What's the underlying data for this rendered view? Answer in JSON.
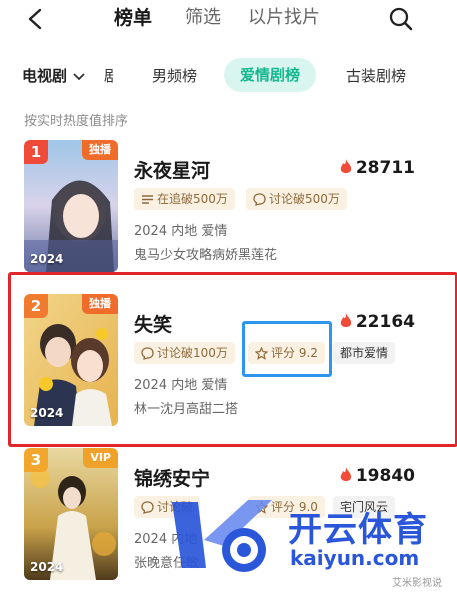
{
  "nav": {
    "tabs": [
      {
        "label": "榜单",
        "active": true
      },
      {
        "label": "筛选",
        "active": false
      },
      {
        "label": "以片找片",
        "active": false
      }
    ]
  },
  "subnav": {
    "dropdown_label": "电视剧",
    "partial_label": "剧",
    "tabs": [
      {
        "label": "男频榜",
        "active": false
      },
      {
        "label": "爱情剧榜",
        "active": true
      },
      {
        "label": "古装剧榜",
        "active": false
      }
    ]
  },
  "sort_note": "按实时热度值排序",
  "items": [
    {
      "rank": "1",
      "badge": "独播",
      "year": "2024",
      "title": "永夜星河",
      "heat": "28711",
      "chips": [
        "在追破500万",
        "讨论破500万"
      ],
      "meta": "2024 内地 爱情",
      "desc": "鬼马少女攻略病娇黑莲花"
    },
    {
      "rank": "2",
      "badge": "独播",
      "year": "2024",
      "title": "失笑",
      "heat": "22164",
      "chips": [
        "讨论破100万",
        "评分 9.2",
        "都市爱情"
      ],
      "meta": "2024 内地 爱情",
      "desc": "林一沈月高甜二搭"
    },
    {
      "rank": "3",
      "badge": "VIP",
      "year": "2024",
      "title": "锦绣安宁",
      "heat": "19840",
      "chips": [
        "讨论破",
        "评分 9.0",
        "宅门风云"
      ],
      "meta": "2024 内地",
      "desc": "张晚意任敏"
    }
  ],
  "watermark": {
    "main": "开云体育",
    "sub": "kaiyun.com",
    "small": "艾米影视说"
  },
  "colors": {
    "accent": "#17b890",
    "rank1": "#f04b3a",
    "rank2": "#f07a2e",
    "rank3": "#f2a72c",
    "badge_exclusive": "#ef6c2b",
    "badge_vip": "#f0a12a",
    "flame": "#f24b3a"
  }
}
